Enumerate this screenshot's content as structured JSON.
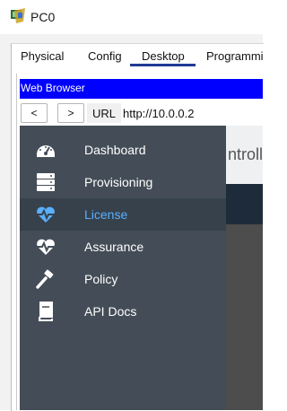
{
  "window": {
    "title": "PC0"
  },
  "tabs": [
    {
      "label": "Physical"
    },
    {
      "label": "Config"
    },
    {
      "label": "Desktop",
      "active": true
    },
    {
      "label": "Programmi"
    }
  ],
  "browser": {
    "title": "Web Browser",
    "back_label": "<",
    "forward_label": ">",
    "url_label": "URL",
    "url_value": "http://10.0.0.2"
  },
  "page": {
    "heading_fragment": "ntroll"
  },
  "sidebar": {
    "items": [
      {
        "label": "Dashboard",
        "icon": "dashboard-gauge-icon"
      },
      {
        "label": "Provisioning",
        "icon": "server-stack-icon"
      },
      {
        "label": "License",
        "icon": "heartbeat-icon",
        "active": true
      },
      {
        "label": "Assurance",
        "icon": "heartbeat-icon"
      },
      {
        "label": "Policy",
        "icon": "gavel-icon"
      },
      {
        "label": "API Docs",
        "icon": "book-icon"
      }
    ]
  },
  "colors": {
    "browser_title_bg": "#0000ff",
    "sidebar_bg": "#444d57",
    "active_item_bg": "#36414c",
    "active_text": "#5ab0ff",
    "active_tab_underline": "#1f3a93"
  }
}
